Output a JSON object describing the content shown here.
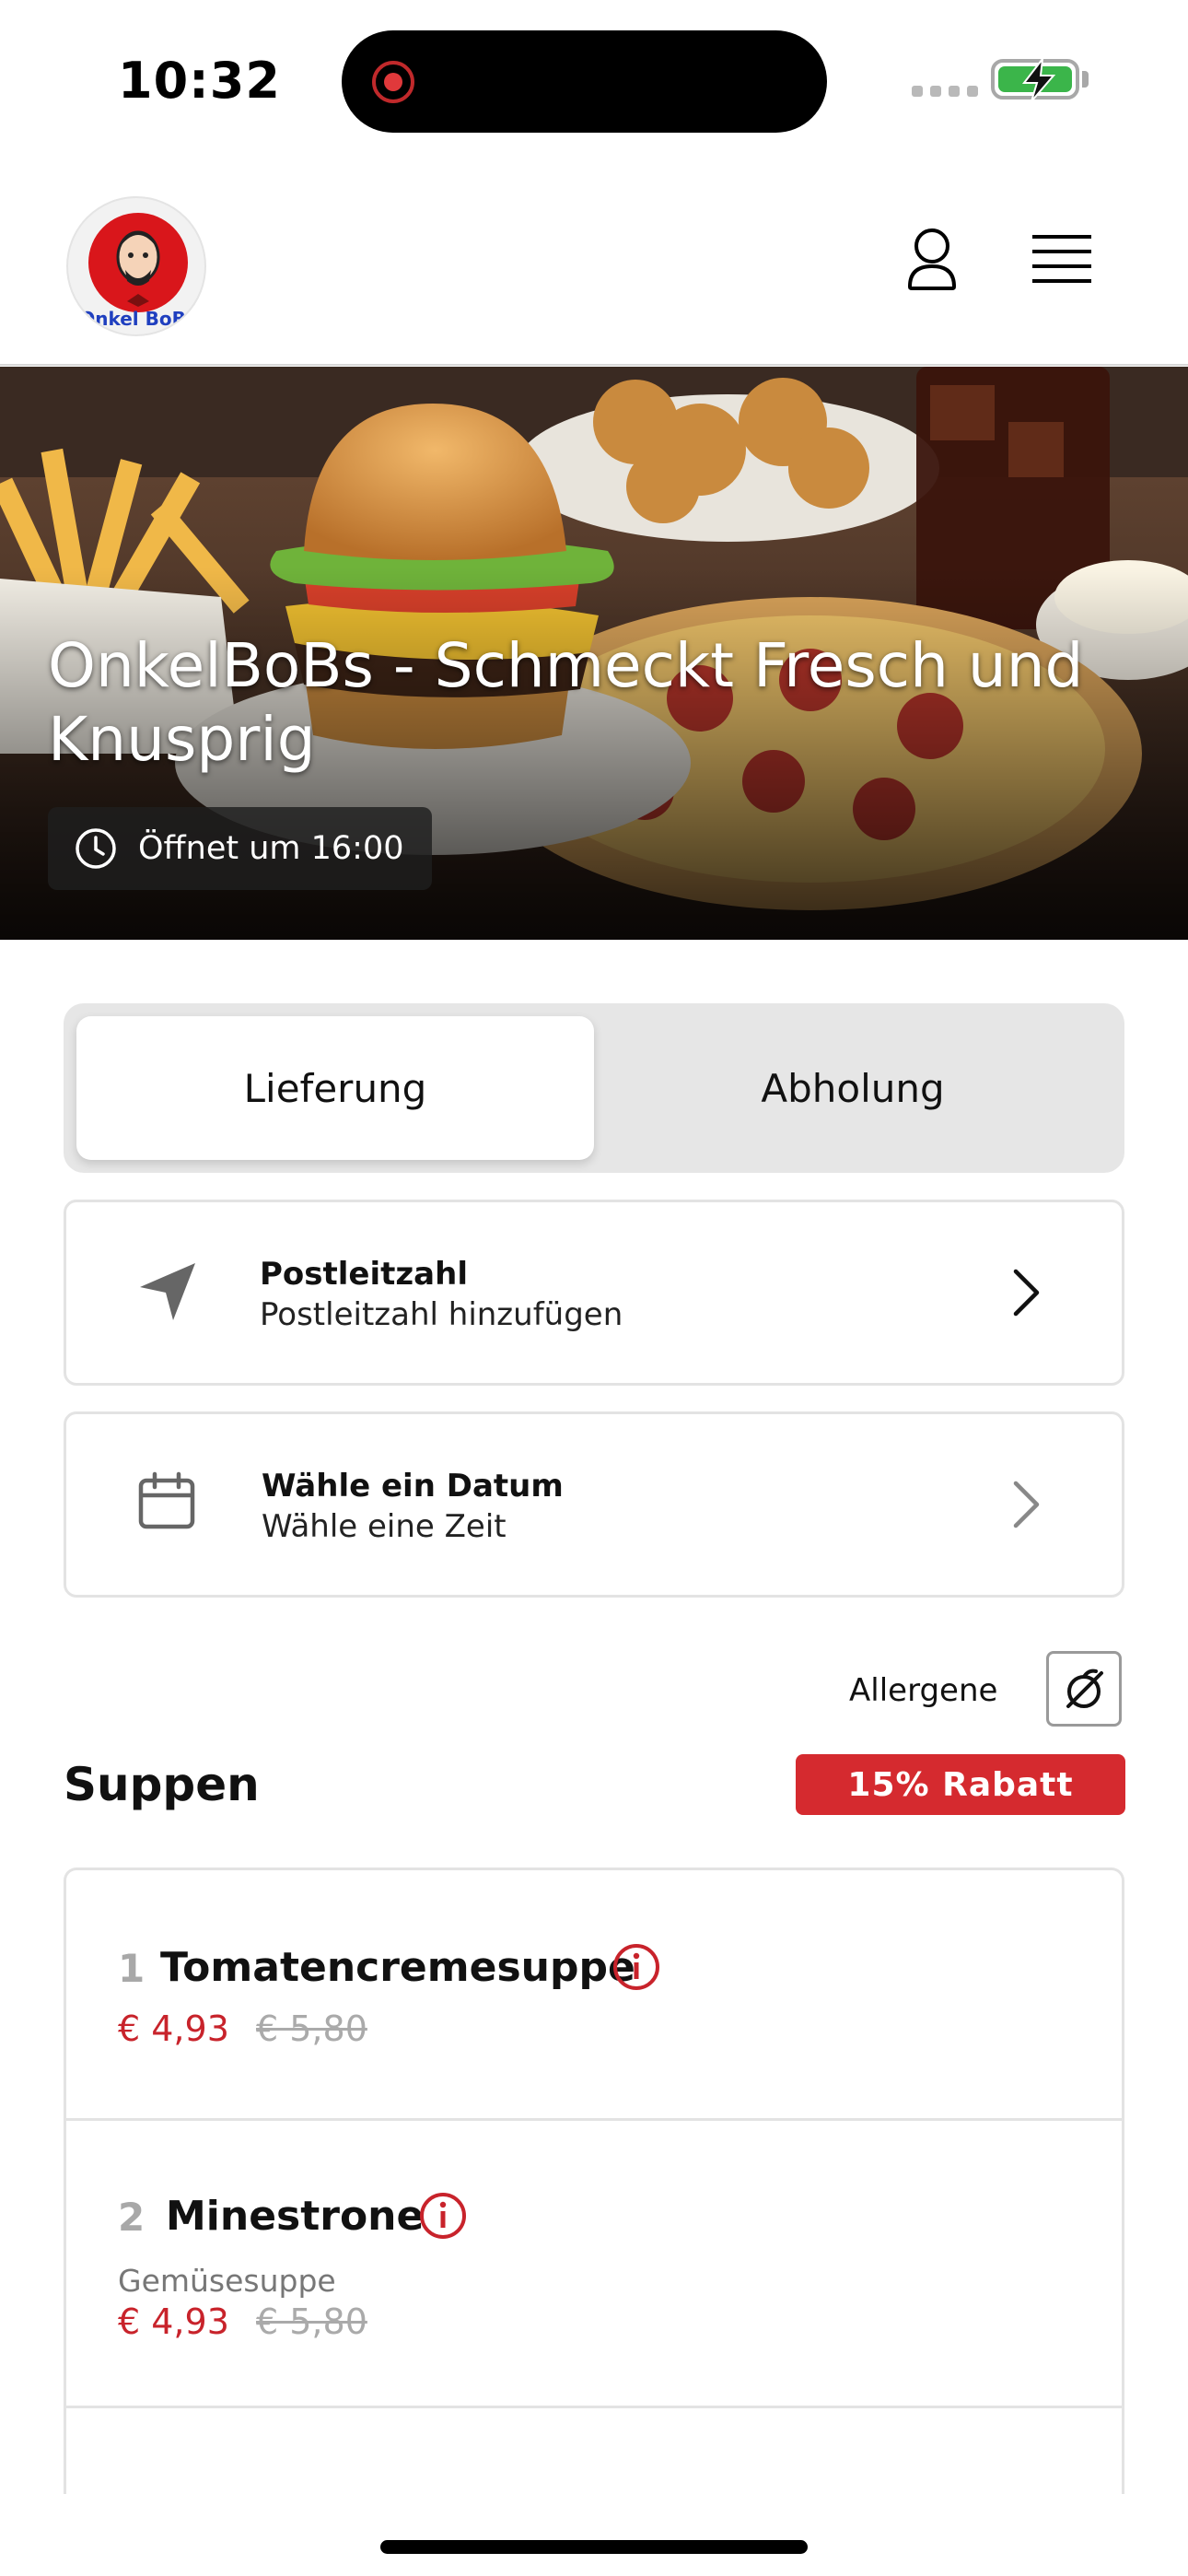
{
  "status_bar": {
    "time": "10:32"
  },
  "header": {
    "logo_text": "Onkel BoBs"
  },
  "hero": {
    "title": "OnkelBoBs - Schmeckt Fresch und Knusprig",
    "hours": "Öffnet um 16:00"
  },
  "order_type": {
    "delivery": "Lieferung",
    "pickup": "Abholung",
    "selected": "Lieferung"
  },
  "postcode": {
    "title": "Postleitzahl",
    "subtitle": "Postleitzahl hinzufügen"
  },
  "schedule": {
    "title": "Wähle ein Datum",
    "subtitle": "Wähle eine Zeit"
  },
  "allergens": {
    "label": "Allergene"
  },
  "section": {
    "title": "Suppen",
    "badge": "15% Rabatt"
  },
  "items": [
    {
      "number": "1",
      "name": "Tomatencremesuppe",
      "description": "",
      "price": "€ 4,93",
      "old_price": "€ 5,80"
    },
    {
      "number": "2",
      "name": "Minestrone",
      "description": "Gemüsesuppe",
      "price": "€ 4,93",
      "old_price": "€ 5,80"
    }
  ],
  "colors": {
    "accent": "#d52a2f",
    "price": "#c8232b",
    "battery": "#3bb54a"
  }
}
